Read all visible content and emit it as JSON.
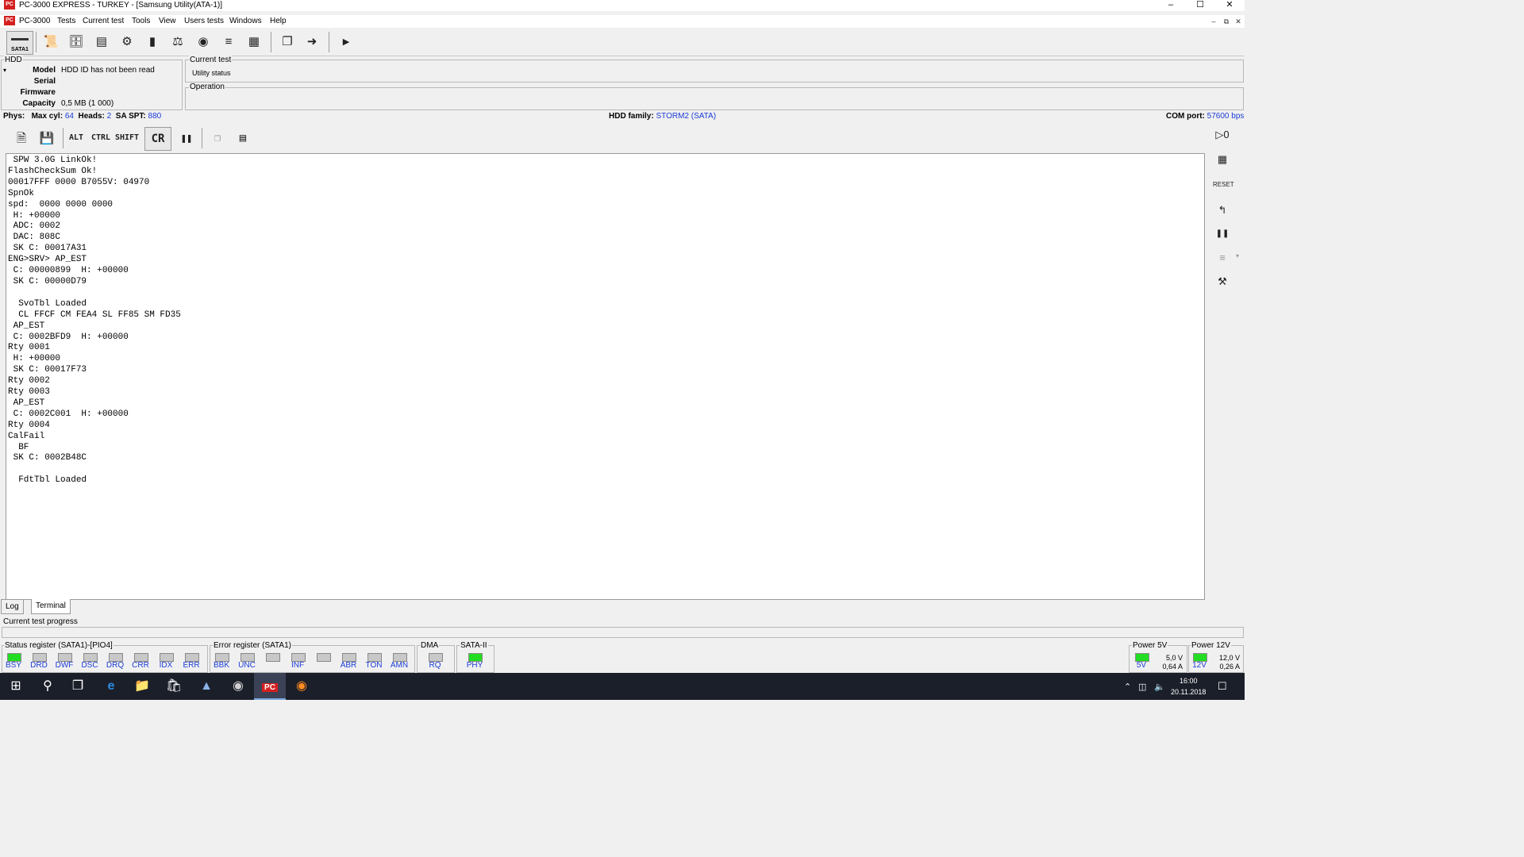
{
  "window": {
    "title": "PC-3000 EXPRESS - TURKEY - [Samsung Utility(ATA-1)]",
    "app_icon_text": "PC"
  },
  "menu": [
    "PC-3000",
    "Tests",
    "Current test",
    "Tools",
    "View",
    "Users tests",
    "Windows",
    "Help"
  ],
  "toolbar": {
    "sata_label": "SATA1"
  },
  "hdd": {
    "group_label": "HDD",
    "model_label": "Model",
    "model_value": "HDD ID has not been read",
    "serial_label": "Serial",
    "serial_value": "",
    "firmware_label": "Firmware",
    "firmware_value": "",
    "capacity_label": "Capacity",
    "capacity_value": "0,5 MB (1 000)"
  },
  "current_test": {
    "group_label": "Current test",
    "value": "Utility status",
    "operation_label": "Operation",
    "operation_value": ""
  },
  "phys": {
    "phys_label": "Phys:",
    "maxcyl_label": "Max cyl:",
    "maxcyl_value": "64",
    "heads_label": "Heads:",
    "heads_value": "2",
    "saspt_label": "SA SPT:",
    "saspt_value": "880",
    "family_label": "HDD family:",
    "family_value": "STORM2 (SATA)",
    "comport_label": "COM port:",
    "comport_value": "57600 bps"
  },
  "terminal_toolbar": {
    "alt": "ALT",
    "ctrl": "CTRL",
    "shift": "SHIFT",
    "cr": "CR"
  },
  "terminal_text": " SPW 3.0G LinkOk!\nFlashCheckSum Ok!\n00017FFF 0000 B7055V: 04970\nSpnOk\nspd:  0000 0000 0000\n H: +00000\n ADC: 0002\n DAC: 808C\n SK C: 00017A31\nENG>SRV> AP_EST\n C: 00000899  H: +00000\n SK C: 00000D79\n\n  SvoTbl Loaded\n  CL FFCF CM FEA4 SL FF85 SM FD35\n AP_EST\n C: 0002BFD9  H: +00000\nRty 0001\n H: +00000\n SK C: 00017F73\nRty 0002\nRty 0003\n AP_EST\n C: 0002C001  H: +00000\nRty 0004\nCalFail\n  BF\n SK C: 0002B48C\n\n  FdtTbl Loaded",
  "tabs": [
    "Log",
    "Terminal"
  ],
  "progress_label": "Current test progress",
  "status_register": {
    "label": "Status register (SATA1)-[PIO4]",
    "leds": [
      {
        "name": "BSY",
        "on": true
      },
      {
        "name": "DRD",
        "on": false
      },
      {
        "name": "DWF",
        "on": false
      },
      {
        "name": "DSC",
        "on": false
      },
      {
        "name": "DRQ",
        "on": false
      },
      {
        "name": "CRR",
        "on": false
      },
      {
        "name": "IDX",
        "on": false
      },
      {
        "name": "ERR",
        "on": false
      }
    ]
  },
  "error_register": {
    "label": "Error register (SATA1)",
    "leds": [
      {
        "name": "BBK",
        "on": false
      },
      {
        "name": "UNC",
        "on": false
      },
      {
        "name": "",
        "on": false
      },
      {
        "name": "INF",
        "on": false
      },
      {
        "name": "",
        "on": false
      },
      {
        "name": "ABR",
        "on": false
      },
      {
        "name": "TON",
        "on": false
      },
      {
        "name": "AMN",
        "on": false
      }
    ]
  },
  "dma": {
    "label": "DMA",
    "led": "RQ",
    "on": false
  },
  "sata2": {
    "label": "SATA-II",
    "led": "PHY",
    "on": true
  },
  "power5": {
    "label": "Power 5V",
    "led": "5V",
    "voltage": "5,0 V",
    "current": "0,64 A",
    "on": true
  },
  "power12": {
    "label": "Power 12V",
    "led": "12V",
    "voltage": "12,0 V",
    "current": "0,26 A",
    "on": true
  },
  "taskbar": {
    "time": "16:00",
    "date": "20.11.2018"
  },
  "colors": {
    "accent_blue": "#1a3cd6",
    "led_on": "#22dd22",
    "led_off": "#c8c8c8",
    "taskbar": "#1b1f2a"
  }
}
